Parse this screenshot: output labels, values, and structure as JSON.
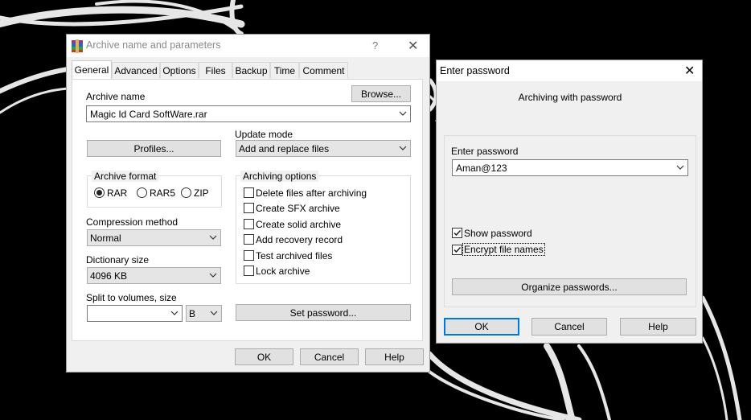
{
  "archive_dialog": {
    "title": "Archive name and parameters",
    "help_glyph": "?",
    "close_glyph": "✕",
    "tabs": [
      {
        "label": "General",
        "active": true
      },
      {
        "label": "Advanced",
        "active": false
      },
      {
        "label": "Options",
        "active": false
      },
      {
        "label": "Files",
        "active": false
      },
      {
        "label": "Backup",
        "active": false
      },
      {
        "label": "Time",
        "active": false
      },
      {
        "label": "Comment",
        "active": false
      }
    ],
    "archive_name_label": "Archive name",
    "browse_label": "Browse...",
    "archive_name_value": "Magic Id Card SoftWare.rar",
    "profiles_label": "Profiles...",
    "update_mode_label": "Update mode",
    "update_mode_value": "Add and replace files",
    "archive_format_label": "Archive format",
    "formats": [
      {
        "label": "RAR",
        "selected": true
      },
      {
        "label": "RAR5",
        "selected": false
      },
      {
        "label": "ZIP",
        "selected": false
      }
    ],
    "archiving_options_label": "Archiving options",
    "options": [
      {
        "label": "Delete files after archiving",
        "checked": false
      },
      {
        "label": "Create SFX archive",
        "checked": false
      },
      {
        "label": "Create solid archive",
        "checked": false
      },
      {
        "label": "Add recovery record",
        "checked": false
      },
      {
        "label": "Test archived files",
        "checked": false
      },
      {
        "label": "Lock archive",
        "checked": false
      }
    ],
    "compression_label": "Compression method",
    "compression_value": "Normal",
    "dictionary_label": "Dictionary size",
    "dictionary_value": "4096 KB",
    "split_label": "Split to volumes, size",
    "split_value": "",
    "split_unit": "B",
    "set_password_label": "Set password...",
    "ok_label": "OK",
    "cancel_label": "Cancel",
    "help_label": "Help"
  },
  "password_dialog": {
    "title": "Enter password",
    "close_glyph": "✕",
    "heading": "Archiving with password",
    "enter_label": "Enter password",
    "password_value": "Aman@123",
    "show_password_label": "Show password",
    "show_password_checked": true,
    "encrypt_label": "Encrypt file names",
    "encrypt_checked": true,
    "organize_label": "Organize passwords...",
    "ok_label": "OK",
    "cancel_label": "Cancel",
    "help_label": "Help"
  },
  "colors": {
    "desktop": "#000000",
    "dialog_bg": "#f0f0f0",
    "accent": "#0078d7"
  }
}
